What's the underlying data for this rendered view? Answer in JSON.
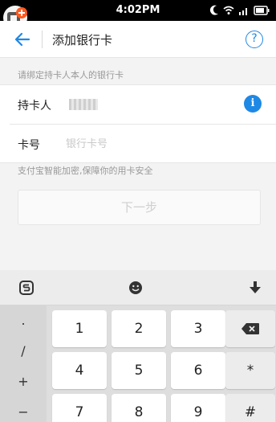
{
  "status_bar": {
    "time": "4:02PM"
  },
  "header": {
    "back_icon": "arrow-left-icon",
    "title": "添加银行卡",
    "help_label": "?"
  },
  "form": {
    "hint": "请绑定持卡人本人的银行卡",
    "holder_label": "持卡人",
    "info_label": "i",
    "card_label": "卡号",
    "card_placeholder": "银行卡号",
    "card_value": "",
    "security_text": "支付宝智能加密,保障你的用卡安全",
    "next_label": "下一步"
  },
  "keyboard": {
    "side_keys": [
      ".",
      "/",
      "+",
      "−"
    ],
    "rows": [
      [
        "1",
        "2",
        "3"
      ],
      [
        "4",
        "5",
        "6"
      ],
      [
        "7",
        "8",
        "9"
      ]
    ],
    "right_keys": [
      "backspace-icon",
      "*",
      "#"
    ],
    "accent": "#1e88e5"
  }
}
